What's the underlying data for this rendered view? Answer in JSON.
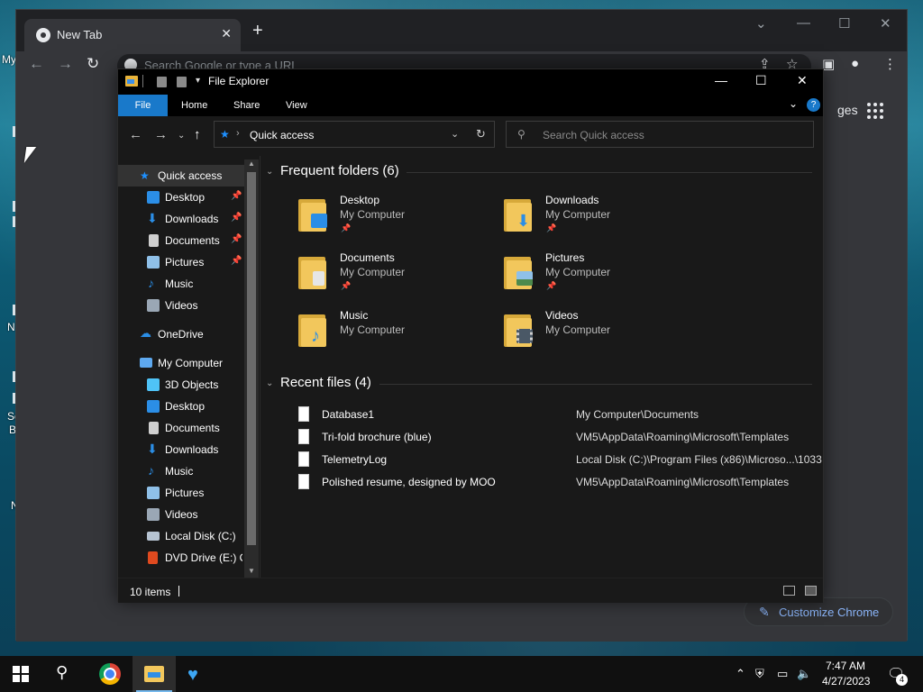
{
  "desktop": {
    "labels": [
      "My",
      "N",
      "Sc",
      "B",
      "N"
    ]
  },
  "chrome": {
    "tab_title": "New Tab",
    "tab_close": "✕",
    "new_tab": "+",
    "minimize": "—",
    "maximize": "☐",
    "close": "✕",
    "tab_search": "⌄",
    "omnibox_placeholder": "Search Google or type a URL",
    "images_link": "ges",
    "customize_label": "Customize Chrome"
  },
  "explorer": {
    "title": "File Explorer",
    "window": {
      "minimize": "—",
      "maximize": "☐",
      "close": "✕"
    },
    "ribbon_tabs": [
      "File",
      "Home",
      "Share",
      "View"
    ],
    "help": "?",
    "address": {
      "location": "Quick access"
    },
    "search_placeholder": "Search Quick access",
    "nav": [
      {
        "label": "Quick access",
        "color": "#1e90ff"
      },
      {
        "label": "Desktop",
        "color": "#2b8ee6",
        "pinned": true
      },
      {
        "label": "Downloads",
        "color": "#2b8ee6",
        "pinned": true
      },
      {
        "label": "Documents",
        "color": "#cfcfcf",
        "pinned": true
      },
      {
        "label": "Pictures",
        "color": "#8fc0e8",
        "pinned": true
      },
      {
        "label": "Music",
        "color": "#2b8ee6"
      },
      {
        "label": "Videos",
        "color": "#9aa7b5"
      },
      {
        "label": "OneDrive",
        "color": "#2b8ee6"
      },
      {
        "label": "My Computer",
        "color": "#5ea9f0"
      },
      {
        "label": "3D Objects",
        "color": "#4fc3f7"
      },
      {
        "label": "Desktop",
        "color": "#2b8ee6"
      },
      {
        "label": "Documents",
        "color": "#cfcfcf"
      },
      {
        "label": "Downloads",
        "color": "#2b8ee6"
      },
      {
        "label": "Music",
        "color": "#2b8ee6"
      },
      {
        "label": "Pictures",
        "color": "#8fc0e8"
      },
      {
        "label": "Videos",
        "color": "#9aa7b5"
      },
      {
        "label": "Local Disk (C:)",
        "color": "#b7c4d2"
      },
      {
        "label": "DVD Drive (E:) O",
        "color": "#e04a1f"
      }
    ],
    "frequent_header": "Frequent folders (6)",
    "frequent": [
      {
        "name": "Desktop",
        "location": "My Computer",
        "pinned": true,
        "badge": "#2b8ee6"
      },
      {
        "name": "Downloads",
        "location": "My Computer",
        "pinned": true,
        "badge": "#2b8ee6"
      },
      {
        "name": "Documents",
        "location": "My Computer",
        "pinned": true,
        "badge": "#e6e6e6"
      },
      {
        "name": "Pictures",
        "location": "My Computer",
        "pinned": true,
        "badge": "#8fc0e8"
      },
      {
        "name": "Music",
        "location": "My Computer",
        "pinned": false,
        "badge": "#2b8ee6"
      },
      {
        "name": "Videos",
        "location": "My Computer",
        "pinned": false,
        "badge": "#4a5866"
      }
    ],
    "recent_header": "Recent files (4)",
    "recent": [
      {
        "name": "Database1",
        "path": "My Computer\\Documents"
      },
      {
        "name": "Tri-fold brochure (blue)",
        "path": "VM5\\AppData\\Roaming\\Microsoft\\Templates"
      },
      {
        "name": "TelemetryLog",
        "path": "Local Disk (C:)\\Program Files (x86)\\Microso...\\1033"
      },
      {
        "name": "Polished resume, designed by MOO",
        "path": "VM5\\AppData\\Roaming\\Microsoft\\Templates"
      }
    ],
    "status": "10 items"
  },
  "taskbar": {
    "time": "7:47 AM",
    "date": "4/27/2023",
    "notification_count": "4"
  },
  "colors": {
    "accent": "#1979ca",
    "chrome_bg": "#202124"
  }
}
